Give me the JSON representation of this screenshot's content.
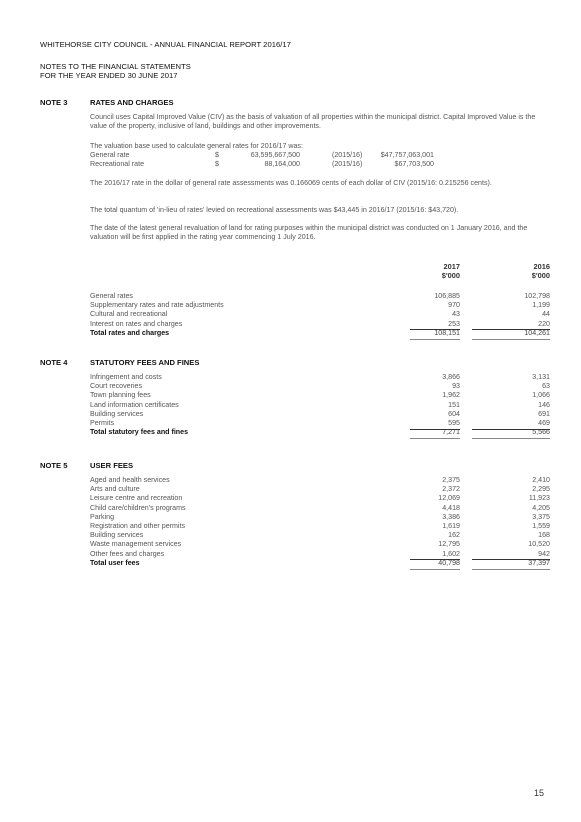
{
  "header": {
    "report_title": "WHITEHORSE CITY COUNCIL - ANNUAL FINANCIAL REPORT 2016/17",
    "section_title": "NOTES TO THE FINANCIAL STATEMENTS",
    "period": "FOR THE YEAR ENDED 30 JUNE 2017"
  },
  "note3": {
    "number": "NOTE 3",
    "title": "RATES AND CHARGES",
    "para1": "Council uses Capital Improved Value (CIV) as the basis of valuation of all properties within the municipal district. Capital Improved Value is the value of the property, inclusive of land, buildings and other improvements.",
    "valuation_intro": "The valuation base used to calculate general rates for 2016/17 was:",
    "valuations": [
      {
        "label": "General rate",
        "currency": "$",
        "value": "63,595,667,500",
        "prior_label": "(2015/16)",
        "prior_value": "$47,757,063,001"
      },
      {
        "label": "Recreational rate",
        "currency": "$",
        "value": "88,164,000",
        "prior_label": "(2015/16)",
        "prior_value": "$67,703,500"
      }
    ],
    "para2": "The 2016/17 rate in the dollar of general rate assessments was 0.166069 cents of each dollar of CIV (2015/16: 0.215256 cents).",
    "para3": "The total quantum of 'in-lieu of rates' levied on recreational assessments was $43,445 in 2016/17 (2015/16: $43,720).",
    "para4": "The date of the latest general revaluation of land for rating purposes within the municipal district was conducted on 1 January 2016, and the valuation will be first applied in the rating year commencing 1 July 2016.",
    "columns": [
      {
        "year": "2017",
        "unit": "$'000"
      },
      {
        "year": "2016",
        "unit": "$'000"
      }
    ],
    "rows": [
      {
        "label": "General rates",
        "v2017": "106,885",
        "v2016": "102,798"
      },
      {
        "label": "Supplementary rates and rate adjustments",
        "v2017": "970",
        "v2016": "1,199"
      },
      {
        "label": "Cultural and recreational",
        "v2017": "43",
        "v2016": "44"
      },
      {
        "label": "Interest on rates and charges",
        "v2017": "253",
        "v2016": "220"
      }
    ],
    "total": {
      "label": "Total rates and charges",
      "v2017": "108,151",
      "v2016": "104,261"
    }
  },
  "note4": {
    "number": "NOTE 4",
    "title": "STATUTORY FEES AND FINES",
    "rows": [
      {
        "label": "Infringement and costs",
        "v2017": "3,866",
        "v2016": "3,131"
      },
      {
        "label": "Court recoveries",
        "v2017": "93",
        "v2016": "63"
      },
      {
        "label": "Town planning fees",
        "v2017": "1,962",
        "v2016": "1,066"
      },
      {
        "label": "Land information certificates",
        "v2017": "151",
        "v2016": "146"
      },
      {
        "label": "Building services",
        "v2017": "604",
        "v2016": "691"
      },
      {
        "label": "Permits",
        "v2017": "595",
        "v2016": "469"
      }
    ],
    "total": {
      "label": "Total statutory fees and fines",
      "v2017": "7,271",
      "v2016": "5,566"
    }
  },
  "note5": {
    "number": "NOTE 5",
    "title": "USER FEES",
    "rows": [
      {
        "label": "Aged and health services",
        "v2017": "2,375",
        "v2016": "2,410"
      },
      {
        "label": "Arts and culture",
        "v2017": "2,372",
        "v2016": "2,295"
      },
      {
        "label": "Leisure centre and recreation",
        "v2017": "12,069",
        "v2016": "11,923"
      },
      {
        "label": "Child care/children's programs",
        "v2017": "4,418",
        "v2016": "4,205"
      },
      {
        "label": "Parking",
        "v2017": "3,386",
        "v2016": "3,375"
      },
      {
        "label": "Registration and other permits",
        "v2017": "1,619",
        "v2016": "1,559"
      },
      {
        "label": "Building services",
        "v2017": "162",
        "v2016": "168"
      },
      {
        "label": "Waste management services",
        "v2017": "12,795",
        "v2016": "10,520"
      },
      {
        "label": "Other fees and charges",
        "v2017": "1,602",
        "v2016": "942"
      }
    ],
    "total": {
      "label": "Total user fees",
      "v2017": "40,798",
      "v2016": "37,397"
    }
  },
  "footer": {
    "page_number": "15"
  }
}
